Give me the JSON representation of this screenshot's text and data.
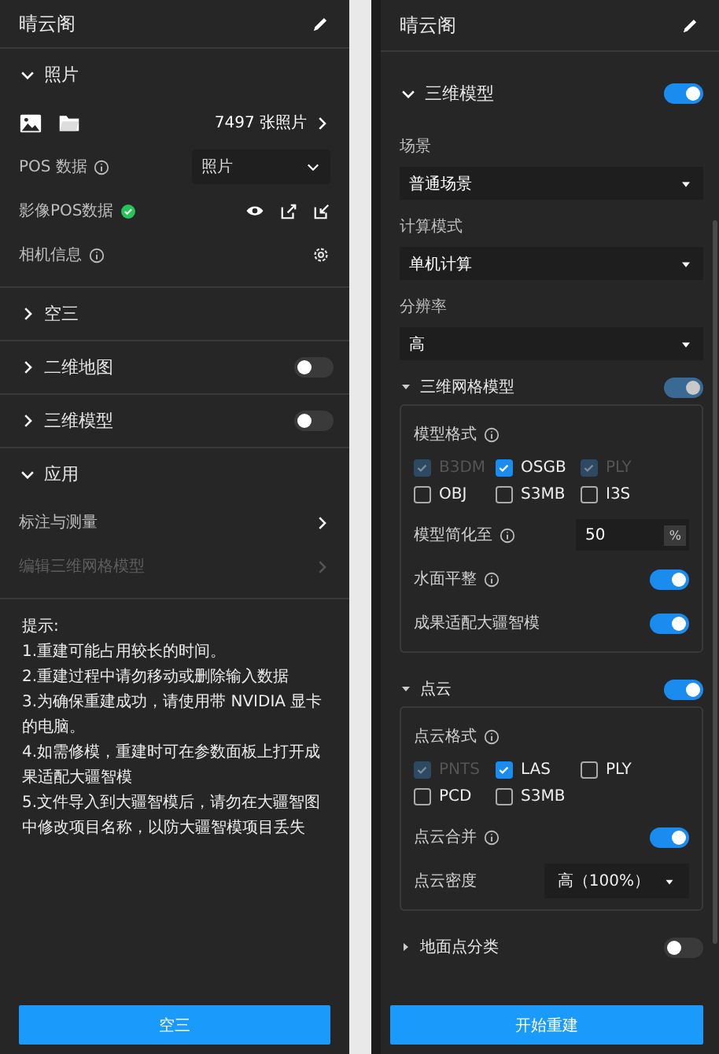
{
  "left_panel": {
    "title": "晴云阁",
    "sections": [
      {
        "label": "照片",
        "expanded": true,
        "rows": [
          {
            "kind": "media",
            "count": "7497 张照片"
          },
          {
            "kind": "select",
            "label": "POS 数据",
            "info": true,
            "value": "照片"
          },
          {
            "kind": "status",
            "label": "影像POS数据",
            "verified": true
          },
          {
            "kind": "settings",
            "label": "相机信息",
            "info": true
          }
        ]
      },
      {
        "label": "空三",
        "expanded": false
      },
      {
        "label": "二维地图",
        "expanded": false,
        "toggle": {
          "on": false
        }
      },
      {
        "label": "三维模型",
        "expanded": false,
        "toggle": {
          "on": false
        }
      },
      {
        "label": "应用",
        "expanded": true,
        "rows": [
          {
            "kind": "link",
            "label": "标注与测量",
            "disabled": false
          },
          {
            "kind": "link",
            "label": "编辑三维网格模型",
            "disabled": true
          }
        ]
      }
    ],
    "tips": {
      "heading": "提示:",
      "lines": [
        "1.重建可能占用较长的时间。",
        "2.重建过程中请勿移动或删除输入数据",
        "3.为确保重建成功，请使用带 NVIDIA 显卡的电脑。",
        "4.如需修模，重建时可在参数面板上打开成果适配大疆智模",
        "5.文件导入到大疆智模后，请勿在大疆智图中修改项目名称，以防大疆智模项目丢失"
      ]
    },
    "button": "空三"
  },
  "right_panel": {
    "title": "晴云阁",
    "section": {
      "label": "三维模型",
      "expanded": true,
      "toggle": {
        "on": true
      },
      "fields": [
        {
          "label": "场景",
          "value": "普通场景"
        },
        {
          "label": "计算模式",
          "value": "单机计算"
        },
        {
          "label": "分辨率",
          "value": "高"
        }
      ],
      "subsections": [
        {
          "label": "三维网格模型",
          "expanded": true,
          "toggle": {
            "on": true,
            "disabled": true
          },
          "rows": [
            {
              "kind": "checks",
              "label": "模型格式",
              "info": true,
              "options": [
                {
                  "label": "B3DM",
                  "checked": true,
                  "disabled": true
                },
                {
                  "label": "OSGB",
                  "checked": true,
                  "disabled": false
                },
                {
                  "label": "PLY",
                  "checked": true,
                  "disabled": true
                },
                {
                  "label": "OBJ",
                  "checked": false,
                  "disabled": false
                },
                {
                  "label": "S3MB",
                  "checked": false,
                  "disabled": false
                },
                {
                  "label": "I3S",
                  "checked": false,
                  "disabled": false
                }
              ]
            },
            {
              "kind": "number",
              "label": "模型简化至",
              "info": true,
              "value": "50",
              "unit": "%"
            },
            {
              "kind": "toggle",
              "label": "水面平整",
              "info": true,
              "on": true
            },
            {
              "kind": "toggle",
              "label": "成果适配大疆智模",
              "info": false,
              "on": true
            }
          ]
        },
        {
          "label": "点云",
          "expanded": true,
          "toggle": {
            "on": true
          },
          "rows": [
            {
              "kind": "checks",
              "label": "点云格式",
              "info": true,
              "options": [
                {
                  "label": "PNTS",
                  "checked": true,
                  "disabled": true
                },
                {
                  "label": "LAS",
                  "checked": true,
                  "disabled": false
                },
                {
                  "label": "PLY",
                  "checked": false,
                  "disabled": false
                },
                {
                  "label": "PCD",
                  "checked": false,
                  "disabled": false
                },
                {
                  "label": "S3MB",
                  "checked": false,
                  "disabled": false
                }
              ]
            },
            {
              "kind": "toggle",
              "label": "点云合并",
              "info": true,
              "on": true
            },
            {
              "kind": "select",
              "label": "点云密度",
              "info": false,
              "value": "高（100%）"
            }
          ]
        },
        {
          "label": "地面点分类",
          "expanded": false,
          "toggle": {
            "on": false
          }
        }
      ]
    },
    "button": "开始重建"
  }
}
